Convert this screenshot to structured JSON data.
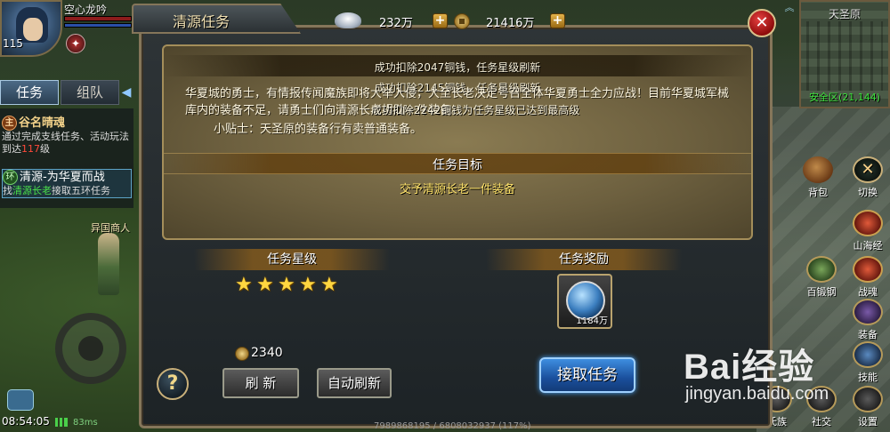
{
  "player": {
    "name": "空心龙吟",
    "level": "115"
  },
  "task_panel": {
    "tabs": [
      "任务",
      "组队"
    ],
    "items": [
      {
        "badge": "主",
        "title": "谷名晴魂",
        "desc_pre": "通过完成支线任务、活动玩法到达",
        "desc_num": "117",
        "desc_post": "级"
      },
      {
        "badge": "环",
        "title": "清源-为华夏而战",
        "desc_pre": "找",
        "desc_npc": "清源长老",
        "desc_post": "接取五环任务"
      }
    ]
  },
  "world": {
    "npc_label": "异国商人"
  },
  "status": {
    "time": "08:54:05",
    "ping": "83ms"
  },
  "minimap": {
    "map_name": "天圣原",
    "safe_zone": "安全区(21,144)"
  },
  "currency": {
    "ingot": "232万",
    "copper": "21416万"
  },
  "side_buttons": [
    "背包",
    "切换",
    "山海经",
    "百锻钢",
    "战魂",
    "装备",
    "技能",
    "氏族",
    "社交",
    "设置"
  ],
  "dialog": {
    "title": "清源任务",
    "notices": [
      "成功扣除2047铜钱，任务星级刷新",
      "成功扣除2145铜钱，任务星级刷新",
      "成功扣除2242铜钱为任务星级已达到最高级"
    ],
    "story": "华夏城的勇士，有情报传闻魔族即将大举入侵，大至长老决定号召全体华夏勇士全力应战！目前华夏城军械库内的装备不足，请勇士们向清源长老捐助一件装备。",
    "tip": "小贴士：天圣原的装备行有卖普通装备。",
    "goal_label": "任务目标",
    "goal_text": "交予清源长老一件装备",
    "star_label": "任务星级",
    "reward_label": "任务奖励",
    "stars": 5,
    "reward_count": "1184万",
    "cost": "2340",
    "refresh_btn": "刷 新",
    "auto_refresh_btn": "自动刷新",
    "accept_btn": "接取任务",
    "footer": "7989868195 / 6808032937 (117%)"
  },
  "watermark": {
    "logo": "Bai经验",
    "url": "jingyan.baidu.com"
  },
  "colors": {
    "accent_blue": "#3e8ee0",
    "gold": "#ffd640",
    "close_red": "#e64040",
    "safe_green": "#3ae03a"
  }
}
